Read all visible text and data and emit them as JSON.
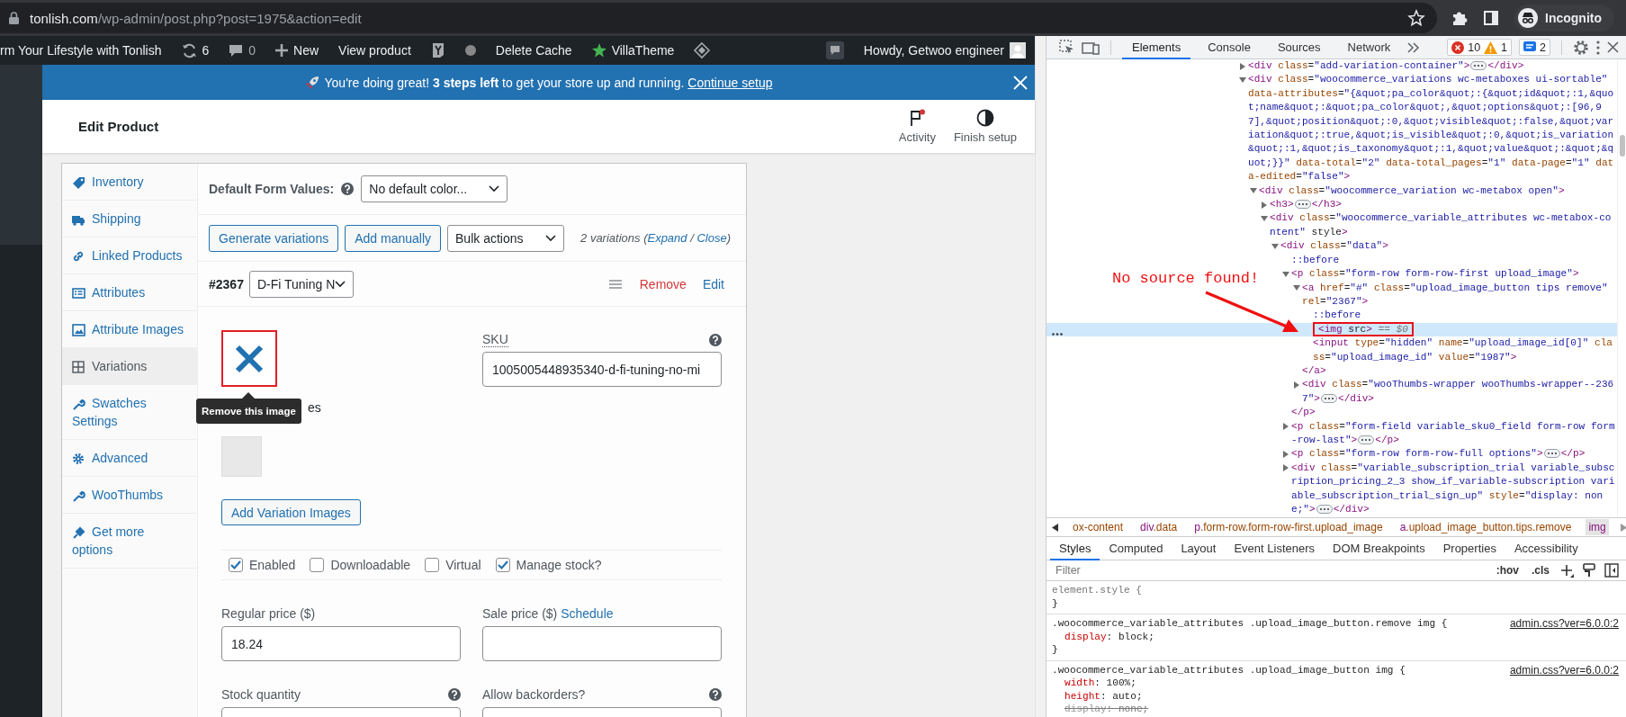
{
  "browser": {
    "url_host": "tonlish.com",
    "url_path": "/wp-admin/post.php?post=1975&action=edit",
    "profile": "Incognito"
  },
  "admin_bar": {
    "site": "rm Your Lifestyle with Tonlish",
    "updates": "6",
    "comments": "0",
    "new": "New",
    "view_product": "View product",
    "delete_cache": "Delete Cache",
    "theme": "VillaTheme",
    "account": "Howdy, Getwoo engineer"
  },
  "notice": {
    "message": "You're doing great! **3 steps left** to get your store up and running.",
    "link": "Continue setup"
  },
  "header": {
    "title": "Edit Product",
    "actions": [
      {
        "label": "Activity",
        "kind": "activity",
        "unread": true
      },
      {
        "label": "Finish setup",
        "kind": "setup",
        "unread": false
      }
    ]
  },
  "product_data": {
    "tabs": [
      {
        "label": "Inventory",
        "selected": false
      },
      {
        "label": "Shipping",
        "selected": false
      },
      {
        "label": "Linked Products",
        "selected": false
      },
      {
        "label": "Attributes",
        "selected": false
      },
      {
        "label": "Attribute Images",
        "selected": false
      },
      {
        "label": "Variations",
        "selected": true
      },
      {
        "label": "Swatches Settings",
        "selected": false
      },
      {
        "label": "Advanced",
        "selected": false
      },
      {
        "label": "WooThumbs",
        "selected": false
      },
      {
        "label": "Get more options",
        "selected": false
      }
    ]
  },
  "variations": {
    "default_label": "Default Form Values:",
    "default_select": "No default color...",
    "buttons": [
      "Generate variations",
      "Add manually"
    ],
    "bulk_select": "Bulk actions",
    "summary": [
      {
        "kind": "text",
        "text": "2 variations ("
      },
      {
        "kind": "link",
        "text": "Expand"
      },
      {
        "kind": "text",
        "text": " / "
      },
      {
        "kind": "link",
        "text": "Close"
      },
      {
        "kind": "text",
        "text": ")"
      }
    ],
    "id": "#2367",
    "attribute_select": "D-Fi Tuning N",
    "remove": "Remove",
    "edit": "Edit",
    "tooltip": "Remove this image",
    "images_label": "es",
    "sku_label": "SKU",
    "sku_value": "1005005448935340-d-fi-tuning-no-mi",
    "add_images": "Add Variation Images",
    "options": [
      {
        "label": "Enabled",
        "checked": true
      },
      {
        "label": "Downloadable",
        "checked": false
      },
      {
        "label": "Virtual",
        "checked": false
      },
      {
        "label": "Manage stock?",
        "checked": true
      }
    ],
    "fields": [
      {
        "label": "Regular price ($)",
        "value": "18.24",
        "help": false
      },
      {
        "label": "Sale price ($)",
        "link": "Schedule",
        "help": false
      },
      {
        "label": "Stock quantity",
        "help": true
      },
      {
        "label": "Allow backorders?",
        "help": true
      }
    ]
  },
  "devtools": {
    "tabs": [
      {
        "label": "Elements",
        "selected": true
      },
      {
        "label": "Console",
        "selected": false
      },
      {
        "label": "Sources",
        "selected": false
      },
      {
        "label": "Network",
        "selected": false
      }
    ],
    "errors": "10",
    "warnings": "1",
    "messages": "2",
    "tree": [
      {
        "kind": "element",
        "open": "<div class=\"add-variation-container\">",
        "close": "</div>",
        "expanded": false,
        "selected": false
      },
      {
        "kind": "element",
        "open": "<div class=\"woocommerce_variations wc-metaboxes ui-sortable\" data-attributes=\"{&quot;pa_color&quot;:{&quot;id&quot;:1,&quot;name&quot;:&quot;pa_color&quot;,&quot;options&quot;:[96,97],&quot;position&quot;:0,&quot;visible&quot;:false,&quot;variation&quot;:true,&quot;is_visible&quot;:0,&quot;is_variation&quot;:1,&quot;is_taxonomy&quot;:1,&quot;value&quot;:&quot;&quot;}}\" data-total=\"2\" data-total_pages=\"1\" data-page=\"1\" data-edited=\"false\">",
        "expanded": true,
        "selected": false,
        "children": [
          {
            "kind": "element",
            "open": "<div class=\"woocommerce_variation wc-metabox open\">",
            "expanded": true,
            "selected": false,
            "children": [
              {
                "kind": "element",
                "open": "<h3>",
                "close": "</h3>",
                "expanded": false,
                "selected": false
              },
              {
                "kind": "element",
                "open": "<div class=\"woocommerce_variable_attributes wc-metabox-content\" style>",
                "expanded": true,
                "selected": false,
                "children": [
                  {
                    "kind": "element",
                    "open": "<div class=\"data\">",
                    "expanded": true,
                    "selected": false,
                    "children": [
                      {
                        "kind": "pseudo",
                        "open": "::before",
                        "selected": false
                      },
                      {
                        "kind": "element",
                        "open": "<p class=\"form-row form-row-first upload_image\">",
                        "close": "</p>",
                        "expanded": true,
                        "selected": false,
                        "children": [
                          {
                            "kind": "element",
                            "open": "<a href=\"#\" class=\"upload_image_button tips remove\" rel=\"2367\">",
                            "close": "</a>",
                            "expanded": true,
                            "selected": false,
                            "children": [
                              {
                                "kind": "pseudo",
                                "open": "::before",
                                "selected": false
                              },
                              {
                                "kind": "leaf",
                                "open": "<img src>",
                                "console_ref": "== $0",
                                "selected": true
                              },
                              {
                                "kind": "leaf",
                                "open": "<input type=\"hidden\" name=\"upload_image_id[0]\" class=\"upload_image_id\" value=\"1987\">",
                                "selected": false
                              }
                            ]
                          },
                          {
                            "kind": "element",
                            "open": "<div class=\"wooThumbs-wrapper wooThumbs-wrapper--2367\">",
                            "close": "</div>",
                            "expanded": false,
                            "selected": false
                          }
                        ]
                      },
                      {
                        "kind": "element",
                        "open": "<p class=\"form-field variable_sku0_field form-row form-row-last\">",
                        "close": "</p>",
                        "expanded": false,
                        "selected": false
                      },
                      {
                        "kind": "element",
                        "open": "<p class=\"form-row form-row-full options\">",
                        "close": "</p>",
                        "expanded": false,
                        "selected": false
                      },
                      {
                        "kind": "element",
                        "open": "<div class=\"variable_subscription_trial variable_subscription_pricing_2_3 show_if_variable-subscription variable_subscription_trial_sign_up\" style=\"display: none;\">",
                        "close": "</div>",
                        "expanded": false,
                        "selected": false
                      }
                    ]
                  }
                ]
              }
            ]
          }
        ]
      }
    ],
    "annotation": {
      "text": "No source found!"
    },
    "breadcrumb": [
      {
        "label": "ox-content",
        "selected": false
      },
      {
        "label": "div.data",
        "selected": false
      },
      {
        "label": "p.form-row.form-row-first.upload_image",
        "selected": false
      },
      {
        "label": "a.upload_image_button.tips.remove",
        "selected": false
      },
      {
        "label": "img",
        "selected": true
      }
    ],
    "style_tabs": [
      {
        "label": "Styles",
        "selected": true
      },
      {
        "label": "Computed",
        "selected": false
      },
      {
        "label": "Layout",
        "selected": false
      },
      {
        "label": "Event Listeners",
        "selected": false
      },
      {
        "label": "DOM Breakpoints",
        "selected": false
      },
      {
        "label": "Properties",
        "selected": false
      },
      {
        "label": "Accessibility",
        "selected": false
      }
    ],
    "filter_placeholder": "Filter",
    "filter_buttons": [
      ":hov",
      ".cls"
    ],
    "rules": [
      {
        "kind": "inline",
        "selector": "element.style {",
        "close": "}"
      },
      {
        "kind": "matched",
        "selector": ".woocommerce_variable_attributes .upload_image_button.remove img {",
        "source": "admin.css?ver=6.0.0:2",
        "declarations": [
          {
            "text": "display: block;",
            "overridden": false
          }
        ],
        "close": "}"
      },
      {
        "kind": "matched",
        "selector": ".woocommerce_variable_attributes .upload_image_button img {",
        "source": "admin.css?ver=6.0.0:2",
        "declarations": [
          {
            "text": "width: 100%;",
            "overridden": false
          },
          {
            "text": "height: auto;",
            "overridden": false
          },
          {
            "text": "display: none;",
            "overridden": true
          }
        ]
      }
    ]
  }
}
